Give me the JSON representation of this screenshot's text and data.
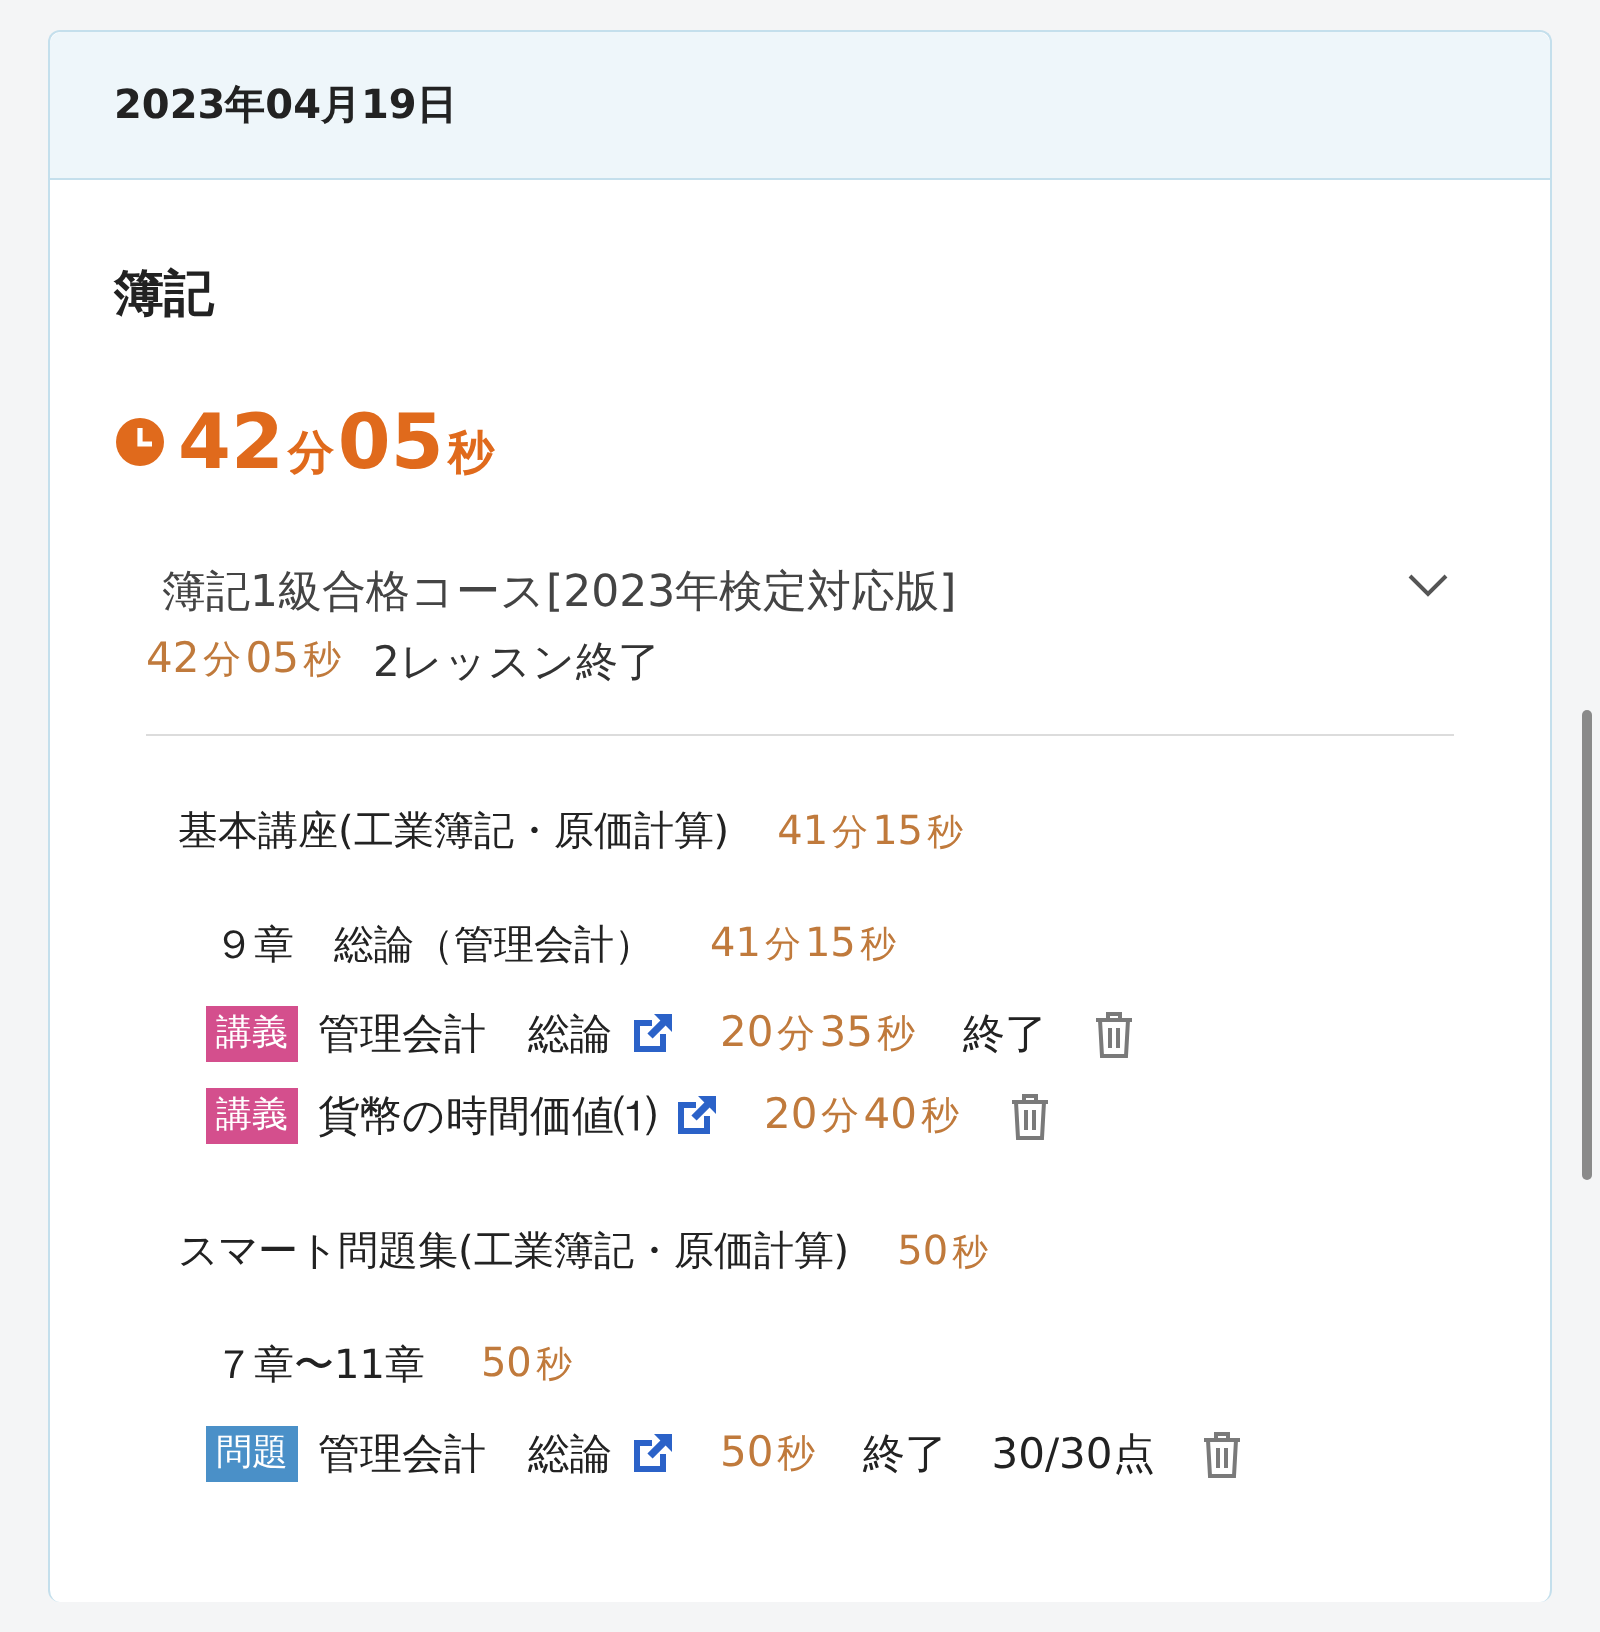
{
  "date": "2023年04月19日",
  "subject": "簿記",
  "total_time": "42分05秒",
  "course": {
    "title": "簿記1級合格コース[2023年検定対応版]",
    "expanded": true,
    "time": "42分05秒",
    "status": "2レッスン終了",
    "sections": [
      {
        "title": "基本講座(工業簿記・原価計算)",
        "time": "41分15秒",
        "chapters": [
          {
            "title": "９章　総論（管理会計）",
            "time": "41分15秒",
            "lessons": [
              {
                "tag": "講義",
                "color": "#d44f8d",
                "title": "管理会計　総論",
                "time": "20分35秒",
                "status": "終了"
              },
              {
                "tag": "講義",
                "color": "#d44f8d",
                "title": "貨幣の時間価値⑴",
                "time": "20分40秒"
              }
            ]
          }
        ]
      },
      {
        "title": "スマート問題集(工業簿記・原価計算)",
        "time": "50秒",
        "chapters": [
          {
            "title": "７章〜11章",
            "time": "50秒",
            "lessons": [
              {
                "tag": "問題",
                "color": "#4a90c8",
                "title": "管理会計　総論",
                "time": "50秒",
                "status": "終了",
                "score": "30/30点"
              }
            ]
          }
        ]
      }
    ]
  }
}
